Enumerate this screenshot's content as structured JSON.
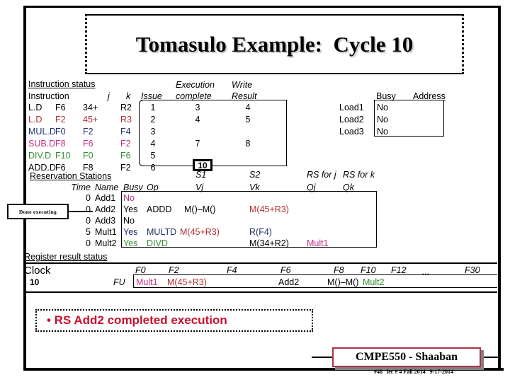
{
  "slide": {
    "title": "Tomasulo Example:  Cycle 10",
    "bullet": "• RS Add2 completed execution",
    "callout_label": "Done executing",
    "cycle_badge": "10"
  },
  "footer": {
    "course": "CMPE550 - Shaaban",
    "sub": "#48   lec # 4 Fall 2014   9-17-2014"
  },
  "instruction_status": {
    "section_title": "Instruction status",
    "headers": {
      "instruction": "Instruction",
      "j": "j",
      "k": "k",
      "issue": "Issue",
      "exec_top": "Execution",
      "exec_bottom": "complete",
      "write_top": "Write",
      "write_bottom": "Result"
    },
    "rows": [
      {
        "op": "L.D",
        "dest": "F6",
        "j": "34+",
        "k": "R2",
        "issue": "1",
        "exec": "3",
        "write": "4",
        "color": "c-black"
      },
      {
        "op": "L.D",
        "dest": "F2",
        "j": "45+",
        "k": "R3",
        "issue": "2",
        "exec": "4",
        "write": "5",
        "color": "c-red"
      },
      {
        "op": "MUL.D",
        "dest": "F0",
        "j": "F2",
        "k": "F4",
        "issue": "3",
        "exec": "",
        "write": "",
        "color": "c-navy"
      },
      {
        "op": "SUB.D",
        "dest": "F8",
        "j": "F6",
        "k": "F2",
        "issue": "4",
        "exec": "7",
        "write": "8",
        "color": "c-pink"
      },
      {
        "op": "DIV.D",
        "dest": "F10",
        "j": "F0",
        "k": "F6",
        "issue": "5",
        "exec": "",
        "write": "",
        "color": "c-green"
      },
      {
        "op": "ADD.D",
        "dest": "F6",
        "j": "F8",
        "k": "F2",
        "issue": "6",
        "exec": "",
        "write": "",
        "color": "c-black"
      }
    ]
  },
  "load_buffers": {
    "headers": {
      "busy": "Busy",
      "address": "Address"
    },
    "rows": [
      {
        "name": "Load1",
        "busy": "No",
        "address": ""
      },
      {
        "name": "Load2",
        "busy": "No",
        "address": ""
      },
      {
        "name": "Load3",
        "busy": "No",
        "address": ""
      }
    ]
  },
  "reservation_stations": {
    "section_title": "Reservation Stations",
    "headers": {
      "s1": "S1",
      "s2": "S2",
      "rsj": "RS for j",
      "rsk": "RS for k",
      "time": "Time",
      "name": "Name",
      "busy": "Busy",
      "op": "Op",
      "vj": "Vj",
      "vk": "Vk",
      "qj": "Qj",
      "qk": "Qk"
    },
    "rows": [
      {
        "time": "0",
        "name": "Add1",
        "busy": "No",
        "op": "",
        "vj": "",
        "vk": "",
        "qj": "",
        "qk": "",
        "busy_color": "c-pink",
        "op_color": "c-black",
        "vj_color": "c-black",
        "vk_color": "c-black",
        "qj_color": "c-black"
      },
      {
        "time": "0",
        "name": "Add2",
        "busy": "Yes",
        "op": "ADDD",
        "vj": "M()–M()",
        "vk": "M(45+R3)",
        "qj": "",
        "qk": "",
        "busy_color": "c-black",
        "op_color": "c-black",
        "vj_color": "c-black",
        "vk_color": "c-red",
        "qj_color": "c-black"
      },
      {
        "time": "0",
        "name": "Add3",
        "busy": "No",
        "op": "",
        "vj": "",
        "vk": "",
        "qj": "",
        "qk": "",
        "busy_color": "c-black",
        "op_color": "c-black",
        "vj_color": "c-black",
        "vk_color": "c-black",
        "qj_color": "c-black"
      },
      {
        "time": "5",
        "name": "Mult1",
        "busy": "Yes",
        "op": "MULTD",
        "vj": "M(45+R3)",
        "vk": "R(F4)",
        "qj": "",
        "qk": "",
        "busy_color": "c-navy",
        "op_color": "c-navy",
        "vj_color": "c-red",
        "vk_color": "c-navy",
        "qj_color": "c-black"
      },
      {
        "time": "0",
        "name": "Mult2",
        "busy": "Yes",
        "op": "DIVD",
        "vj": "",
        "vk": "M(34+R2)",
        "qj": "Mult1",
        "qk": "",
        "busy_color": "c-green",
        "op_color": "c-green",
        "vj_color": "c-black",
        "vk_color": "c-black",
        "qj_color": "c-pink"
      }
    ]
  },
  "register_result_status": {
    "section_title": "Register result status",
    "clock_label": "Clock",
    "clock_value": "10",
    "fu_label": "FU",
    "registers": [
      "F0",
      "F2",
      "F4",
      "F6",
      "F8",
      "F10",
      "F12",
      "...",
      "F30"
    ],
    "values": [
      {
        "reg": "F0",
        "value": "Mult1",
        "color": "c-pink"
      },
      {
        "reg": "F2",
        "value": "M(45+R3)",
        "color": "c-red"
      },
      {
        "reg": "F4",
        "value": "",
        "color": "c-black"
      },
      {
        "reg": "F6",
        "value": "Add2",
        "color": "c-black"
      },
      {
        "reg": "F8",
        "value": "M()–M()",
        "color": "c-black"
      },
      {
        "reg": "F10",
        "value": "Mult2",
        "color": "c-green"
      },
      {
        "reg": "F12",
        "value": "",
        "color": "c-black"
      },
      {
        "reg": "...",
        "value": "",
        "color": "c-black"
      },
      {
        "reg": "F30",
        "value": "",
        "color": "c-black"
      }
    ]
  },
  "colors": {
    "red": "#B03030",
    "navy": "#203070",
    "pink": "#C0308A",
    "green": "#309030",
    "bullet_red": "#C8102E",
    "footer_border": "#B03040"
  }
}
